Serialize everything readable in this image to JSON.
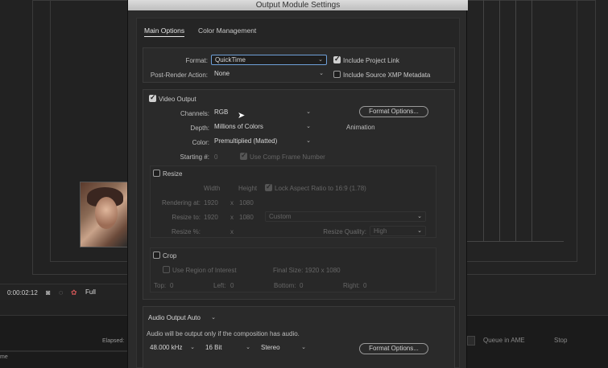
{
  "background": {
    "timecode": "0:00:02:12",
    "zoom": "Full",
    "elapsed_label": "Elapsed:",
    "queue_ame": "Queue in AME",
    "stop": "Stop",
    "bottom_left": "me"
  },
  "dialog": {
    "title": "Output Module Settings",
    "tabs": [
      {
        "label": "Main Options",
        "active": true
      },
      {
        "label": "Color Management",
        "active": false
      }
    ],
    "format": {
      "label": "Format:",
      "value": "QuickTime"
    },
    "post_render": {
      "label": "Post-Render Action:",
      "value": "None"
    },
    "include_project_link": {
      "label": "Include Project Link",
      "checked": true
    },
    "include_xmp": {
      "label": "Include Source XMP Metadata",
      "checked": false
    },
    "video": {
      "enabled_label": "Video Output",
      "enabled": true,
      "channels": {
        "label": "Channels:",
        "value": "RGB"
      },
      "depth": {
        "label": "Depth:",
        "value": "Millions of Colors"
      },
      "color": {
        "label": "Color:",
        "value": "Premultiplied (Matted)"
      },
      "starting": {
        "label": "Starting #:",
        "value": "0"
      },
      "use_comp_frame": "Use Comp Frame Number",
      "format_options": "Format Options...",
      "codec": "Animation"
    },
    "resize": {
      "label": "Resize",
      "checked": false,
      "width": "Width",
      "height": "Height",
      "lock_aspect": "Lock Aspect Ratio to 16:9 (1.78)",
      "rendering_at": {
        "label": "Rendering at:",
        "w": "1920",
        "x": "x",
        "h": "1080"
      },
      "resize_to": {
        "label": "Resize to:",
        "w": "1920",
        "x": "x",
        "h": "1080",
        "preset": "Custom"
      },
      "resize_pct": {
        "label": "Resize %:",
        "x": "x"
      },
      "quality": {
        "label": "Resize Quality:",
        "value": "High"
      }
    },
    "crop": {
      "label": "Crop",
      "checked": false,
      "use_roi": "Use Region of Interest",
      "final_size": "Final Size: 1920 x 1080",
      "top": {
        "label": "Top:",
        "value": "0"
      },
      "left": {
        "label": "Left:",
        "value": "0"
      },
      "bottom": {
        "label": "Bottom:",
        "value": "0"
      },
      "right": {
        "label": "Right:",
        "value": "0"
      }
    },
    "audio": {
      "mode": "Audio Output Auto",
      "note": "Audio will be output only if the composition has audio.",
      "rate": "48.000 kHz",
      "bits": "16 Bit",
      "channels": "Stereo",
      "format_options": "Format Options..."
    }
  }
}
